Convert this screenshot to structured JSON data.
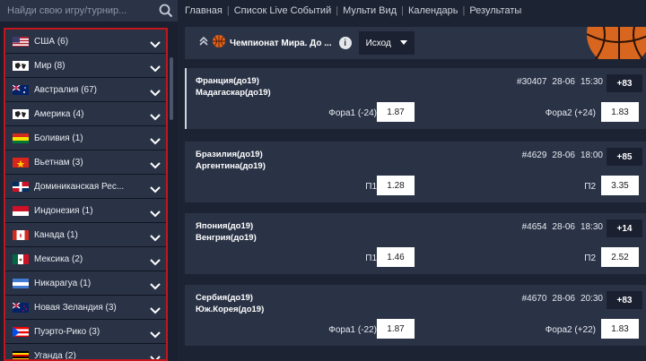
{
  "search": {
    "placeholder": "Найди свою игру/турнир..."
  },
  "nav": [
    "Главная",
    "Список Live Событий",
    "Мульти Вид",
    "Календарь",
    "Результаты"
  ],
  "header": {
    "title": "Чемпионат Мира. До ...",
    "info": "i",
    "dropdown": "Исход"
  },
  "countries": [
    {
      "name": "США (6)",
      "flag": "us"
    },
    {
      "name": "Мир (8)",
      "flag": "world"
    },
    {
      "name": "Австралия (67)",
      "flag": "au"
    },
    {
      "name": "Америка (4)",
      "flag": "world"
    },
    {
      "name": "Боливия (1)",
      "flag": "bo"
    },
    {
      "name": "Вьетнам (3)",
      "flag": "vn"
    },
    {
      "name": "Доминиканская Рес...",
      "flag": "do"
    },
    {
      "name": "Индонезия (1)",
      "flag": "id"
    },
    {
      "name": "Канада (1)",
      "flag": "ca"
    },
    {
      "name": "Мексика (2)",
      "flag": "mx"
    },
    {
      "name": "Никарагуа (1)",
      "flag": "ni"
    },
    {
      "name": "Новая Зеландия (3)",
      "flag": "nz"
    },
    {
      "name": "Пуэрто-Рико (3)",
      "flag": "pr"
    },
    {
      "name": "Уганда (2)",
      "flag": "ug"
    }
  ],
  "matches": [
    {
      "team1": "Франция(до19)",
      "team2": "Мадагаскар(до19)",
      "id": "#30407",
      "date": "28-06",
      "time": "15:30",
      "count": "+83",
      "left_label": "Фора1 (-24)",
      "left_odd": "1.87",
      "right_label": "Фора2 (+24)",
      "right_odd": "1.83"
    },
    {
      "team1": "Бразилия(до19)",
      "team2": "Аргентина(до19)",
      "id": "#4629",
      "date": "28-06",
      "time": "18:00",
      "count": "+85",
      "left_label": "П1",
      "left_odd": "1.28",
      "right_label": "П2",
      "right_odd": "3.35"
    },
    {
      "team1": "Япония(до19)",
      "team2": "Венгрия(до19)",
      "id": "#4654",
      "date": "28-06",
      "time": "18:30",
      "count": "+14",
      "left_label": "П1",
      "left_odd": "1.46",
      "right_label": "П2",
      "right_odd": "2.52"
    },
    {
      "team1": "Сербия(до19)",
      "team2": "Юж.Корея(до19)",
      "id": "#4670",
      "date": "28-06",
      "time": "20:30",
      "count": "+83",
      "left_label": "Фора1 (-22)",
      "left_odd": "1.87",
      "right_label": "Фора2 (+22)",
      "right_odd": "1.83"
    }
  ],
  "colors": {
    "accent_red": "#c4151c",
    "panel": "#2a3346",
    "background": "#1c2333"
  }
}
